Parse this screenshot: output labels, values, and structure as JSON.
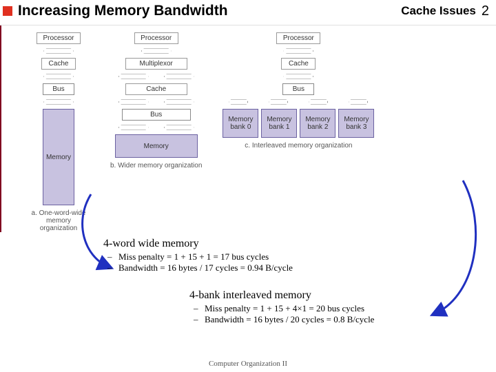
{
  "header": {
    "title": "Increasing Memory Bandwidth",
    "topic": "Cache Issues",
    "page": "2"
  },
  "diagramA": {
    "processor": "Processor",
    "cache": "Cache",
    "bus": "Bus",
    "memory": "Memory",
    "caption": "a. One-word-wide memory organization"
  },
  "diagramB": {
    "processor": "Processor",
    "mux": "Multiplexor",
    "cache": "Cache",
    "bus": "Bus",
    "memory": "Memory",
    "caption": "b. Wider memory organization"
  },
  "diagramC": {
    "processor": "Processor",
    "cache": "Cache",
    "bus": "Bus",
    "banks": [
      "Memory bank 0",
      "Memory bank 1",
      "Memory bank 2",
      "Memory bank 3"
    ],
    "caption": "c. Interleaved memory organization"
  },
  "section1": {
    "heading": "4-word wide memory",
    "b1": "Miss penalty = 1 + 15 + 1 = 17 bus cycles",
    "b2": "Bandwidth = 16 bytes / 17 cycles = 0.94 B/cycle"
  },
  "section2": {
    "heading": "4-bank interleaved memory",
    "b1": "Miss penalty = 1 + 15 + 4×1 = 20 bus cycles",
    "b2": "Bandwidth = 16 bytes / 20 cycles = 0.8 B/cycle"
  },
  "footer": "Computer Organization II"
}
